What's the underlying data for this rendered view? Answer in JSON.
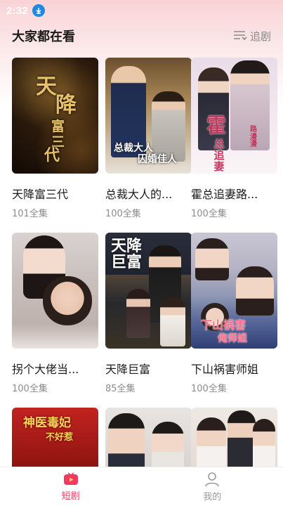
{
  "status": {
    "time": "2:32"
  },
  "header": {
    "title": "大家都在看",
    "follow_label": "追剧"
  },
  "posters": {
    "p1": [
      "天",
      "降",
      "富",
      "三",
      "代"
    ],
    "p2_line1": "总裁大人",
    "p2_line2": "囚婚佳人",
    "p3_line1": "霍",
    "p3_line2": "总追妻",
    "p3_line3": "路漫漫",
    "p5_line1": "天降",
    "p5_line2": "巨富",
    "p6_line1": "下山祸害",
    "p6_line2": "俺师姐",
    "p7_line1": "神医毒妃",
    "p7_line2": "不好惹"
  },
  "dramas": [
    {
      "title": "天降富三代",
      "episodes": "101全集"
    },
    {
      "title": "总裁大人的...",
      "episodes": "100全集"
    },
    {
      "title": "霍总追妻路...",
      "episodes": "100全集"
    },
    {
      "title": "拐个大佬当...",
      "episodes": "100全集"
    },
    {
      "title": "天降巨富",
      "episodes": "85全集"
    },
    {
      "title": "下山祸害师姐",
      "episodes": "100全集"
    }
  ],
  "nav": [
    {
      "label": "短剧",
      "icon": "tv-icon",
      "active": true
    },
    {
      "label": "我的",
      "icon": "person-icon",
      "active": false
    }
  ],
  "colors": {
    "accent": "#f03a5f",
    "status_icon": "#1e88e5"
  }
}
